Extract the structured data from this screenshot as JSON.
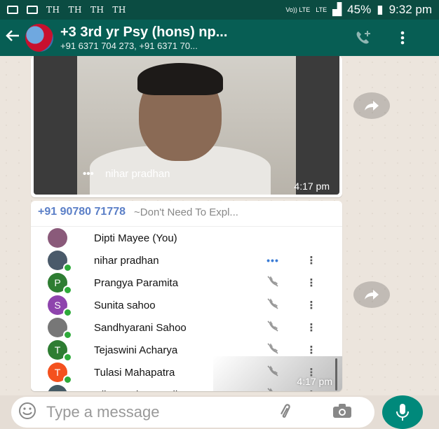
{
  "status_bar": {
    "carrier_texts": [
      "TH",
      "TH",
      "TH",
      "TH"
    ],
    "signal_labels": [
      "Vo)) LTE",
      "LTE"
    ],
    "battery": "45%",
    "time": "9:32 pm"
  },
  "header": {
    "title": "+3 3rd yr Psy (hons) np...",
    "subtitle": "+91 6371 704 273, +91 6371 70..."
  },
  "video_message": {
    "name_tag": "nihar pradhan",
    "time": "4:17 pm"
  },
  "call_message": {
    "sender_number": "+91 90780 71778",
    "sender_note": "~Don't Need To Expl...",
    "time": "4:17 pm",
    "participants": [
      {
        "name": "Dipti Mayee (You)",
        "initial": "",
        "color": "#8a5a7a",
        "status": ""
      },
      {
        "name": "nihar pradhan",
        "initial": "",
        "color": "#4a5a6a",
        "status": "•••"
      },
      {
        "name": "Prangya Paramita",
        "initial": "P",
        "color": "#2e7d32",
        "status": "muted"
      },
      {
        "name": "Sunita sahoo",
        "initial": "S",
        "color": "#8e44ad",
        "status": "muted"
      },
      {
        "name": "Sandhyarani Sahoo",
        "initial": "",
        "color": "#777777",
        "status": "muted"
      },
      {
        "name": "Tejaswini Acharya",
        "initial": "T",
        "color": "#2e7d32",
        "status": "muted"
      },
      {
        "name": "Tulasi Mahapatra",
        "initial": "T",
        "color": "#f4511e",
        "status": "muted"
      },
      {
        "name": "Dibyaranjan Pradhan",
        "initial": "D",
        "color": "#455a64",
        "status": "muted"
      }
    ]
  },
  "input": {
    "placeholder": "Type a message"
  },
  "colors": {
    "header": "#075e54",
    "status_bar": "#0b4c42",
    "accent": "#00897b"
  }
}
